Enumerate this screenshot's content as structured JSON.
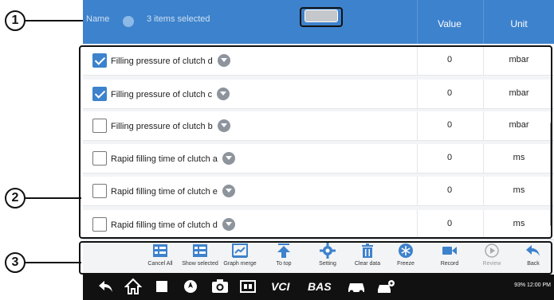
{
  "callouts": [
    "1",
    "2",
    "3"
  ],
  "header": {
    "name_label": "Name",
    "selected_text": "3 items selected",
    "value_label": "Value",
    "unit_label": "Unit"
  },
  "rows": [
    {
      "label": "Filling pressure of clutch d",
      "value": "0",
      "unit": "mbar",
      "checked": true
    },
    {
      "label": "Filling pressure of clutch c",
      "value": "0",
      "unit": "mbar",
      "checked": true
    },
    {
      "label": "Filling pressure of clutch b",
      "value": "0",
      "unit": "mbar",
      "checked": false
    },
    {
      "label": "Rapid filling time of  clutch a",
      "value": "0",
      "unit": "ms",
      "checked": false
    },
    {
      "label": "Rapid filling time of  clutch e",
      "value": "0",
      "unit": "ms",
      "checked": false
    },
    {
      "label": "Rapid filling time of  clutch d",
      "value": "0",
      "unit": "ms",
      "checked": false
    }
  ],
  "toolbar": [
    {
      "label": "Cancel All",
      "icon": "cancel-all-icon"
    },
    {
      "label": "Show selected",
      "icon": "show-selected-icon"
    },
    {
      "label": "Graph merge",
      "icon": "graph-merge-icon"
    },
    {
      "label": "To top",
      "icon": "to-top-icon"
    },
    {
      "label": "Setting",
      "icon": "gear-icon"
    },
    {
      "label": "Clear data",
      "icon": "trash-icon"
    },
    {
      "label": "Freeze",
      "icon": "snowflake-icon"
    },
    {
      "label": "Record",
      "icon": "video-camera-icon"
    },
    {
      "label": "Review",
      "icon": "play-circle-icon"
    },
    {
      "label": "Back",
      "icon": "back-arrow-icon"
    }
  ],
  "navbar": {
    "status": "93% 12:00 PM",
    "brand_vci": "VCI",
    "brand_bas": "BAS"
  },
  "colors": {
    "header_blue": "#3d82cc",
    "toolbar_icon_blue": "#3d82cc",
    "navbar_bg": "#111111"
  }
}
